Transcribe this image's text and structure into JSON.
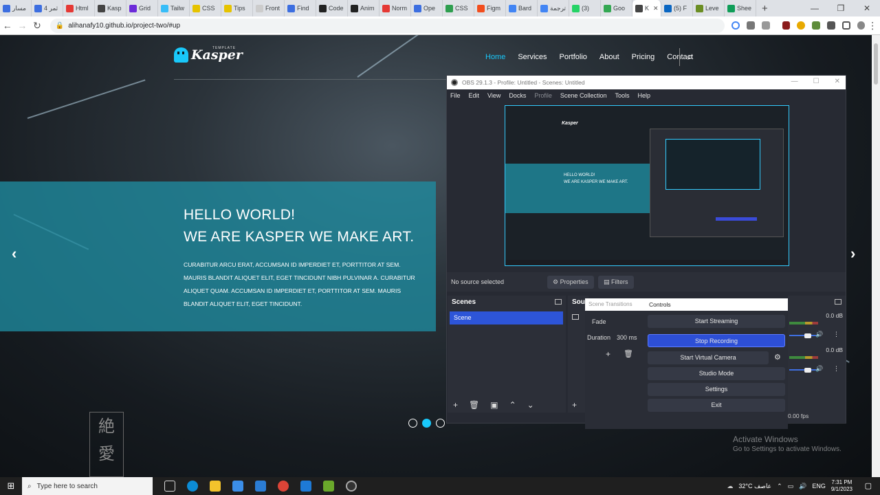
{
  "browser": {
    "tabs": [
      {
        "label": "مسار",
        "color": "#3c6ee0"
      },
      {
        "label": "4 ثمر",
        "color": "#3c6ee0"
      },
      {
        "label": "Html",
        "color": "#e53935"
      },
      {
        "label": "Kasp",
        "color": "#444444"
      },
      {
        "label": "Grid",
        "color": "#6c2bd9"
      },
      {
        "label": "Tailw",
        "color": "#38bdf8"
      },
      {
        "label": "CSS",
        "color": "#e6c300"
      },
      {
        "label": "Tips",
        "color": "#e6c300"
      },
      {
        "label": "Front",
        "color": "#cccccc"
      },
      {
        "label": "Find",
        "color": "#3c6ee0"
      },
      {
        "label": "Code",
        "color": "#222222"
      },
      {
        "label": "Anim",
        "color": "#222222"
      },
      {
        "label": "Norm",
        "color": "#e53935"
      },
      {
        "label": "Ope",
        "color": "#3c6ee0"
      },
      {
        "label": "CSS",
        "color": "#2e9e4f"
      },
      {
        "label": "Figm",
        "color": "#f24e1e"
      },
      {
        "label": "Bard",
        "color": "#4285f4"
      },
      {
        "label": "ترجمة",
        "color": "#4285f4"
      },
      {
        "label": "(3)",
        "color": "#25d366"
      },
      {
        "label": "Goo",
        "color": "#34a853"
      },
      {
        "label": "K",
        "color": "#444444",
        "active": true
      },
      {
        "label": "(5) F",
        "color": "#0a66c2"
      },
      {
        "label": "Leve",
        "color": "#6b8e23"
      },
      {
        "label": "Shee",
        "color": "#0f9d58"
      }
    ],
    "tab_close": "✕",
    "new_tab": "+",
    "url": "alihanafy10.github.io/project-two/#up"
  },
  "site": {
    "logo_text": "Kasper",
    "logo_tag": "TEMPLATE",
    "nav": [
      "Home",
      "Services",
      "Portfolio",
      "About",
      "Pricing",
      "Contact"
    ],
    "hero_line1": "HELLO WORLD!",
    "hero_line2": "WE ARE KASPER WE MAKE ART.",
    "hero_text": "CURABITUR ARCU ERAT, ACCUMSAN ID IMPERDIET ET, PORTTITOR AT SEM. MAURIS BLANDIT ALIQUET ELIT, EGET TINCIDUNT NIBH PULVINAR A. CURABITUR ALIQUET QUAM. ACCUMSAN ID IMPERDIET ET, PORTTITOR AT SEM. MAURIS BLANDIT ALIQUET ELIT, EGET TINCIDUNT.",
    "arrow_left": "‹",
    "arrow_right": "›",
    "watermark_title": "Activate Windows",
    "watermark_sub": "Go to Settings to activate Windows.",
    "kanji": "絶\n愛"
  },
  "obs": {
    "title": "OBS 29.1.3 - Profile: Untitled - Scenes: Untitled",
    "menu": [
      "File",
      "Edit",
      "View",
      "Docks",
      "Profile",
      "Scene Collection",
      "Tools",
      "Help"
    ],
    "no_source": "No source selected",
    "properties": "Properties",
    "filters": "Filters",
    "scenes_title": "Scenes",
    "scene_item": "Scene",
    "sources_title": "Sour",
    "transitions_title": "Scene Transitions",
    "transition": "Fade",
    "duration_label": "Duration",
    "duration_value": "300 ms",
    "controls_title": "Controls",
    "controls": [
      "Start Streaming",
      "Stop Recording",
      "Start Virtual Camera",
      "Studio Mode",
      "Settings",
      "Exit"
    ],
    "db1": "0.0 dB",
    "db2": "0.0 dB",
    "fps": "0.00 fps",
    "preview_line1": "HELLO WORLD!",
    "preview_line2": "WE ARE KASPER WE MAKE ART.",
    "preview_logo": "Kasper"
  },
  "taskbar": {
    "search_placeholder": "Type here to search",
    "weather": "32°C عاصف",
    "lang": "ENG",
    "time": "7:31 PM",
    "date": "9/1/2023"
  }
}
